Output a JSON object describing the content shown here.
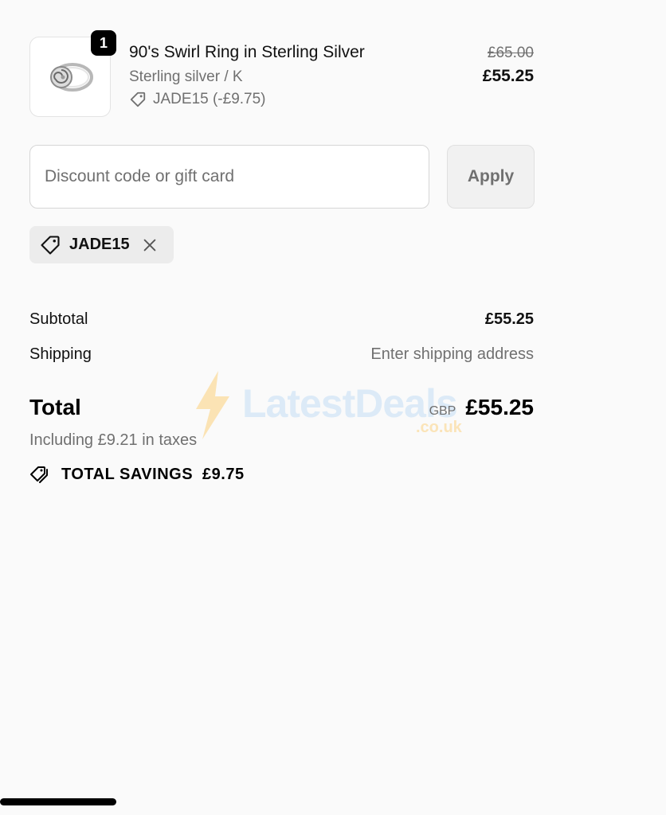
{
  "line_item": {
    "quantity": "1",
    "title": "90's Swirl Ring in Sterling Silver",
    "variant": "Sterling silver / K",
    "discount": "JADE15 (-£9.75)",
    "original_price": "£65.00",
    "price": "£55.25"
  },
  "discount_form": {
    "placeholder": "Discount code or gift card",
    "apply_label": "Apply"
  },
  "applied_code": {
    "label": "JADE15"
  },
  "summary": {
    "subtotal_label": "Subtotal",
    "subtotal_value": "£55.25",
    "shipping_label": "Shipping",
    "shipping_value": "Enter shipping address",
    "total_label": "Total",
    "currency": "GBP",
    "total_value": "£55.25",
    "tax_note": "Including £9.21 in taxes",
    "savings_label": "TOTAL SAVINGS",
    "savings_value": "£9.75"
  },
  "watermark": {
    "text": "LatestDeals",
    "sub": ".co.uk"
  },
  "icons": {
    "tag": "tag-icon",
    "close": "close-icon",
    "savings": "price-tags-icon"
  }
}
